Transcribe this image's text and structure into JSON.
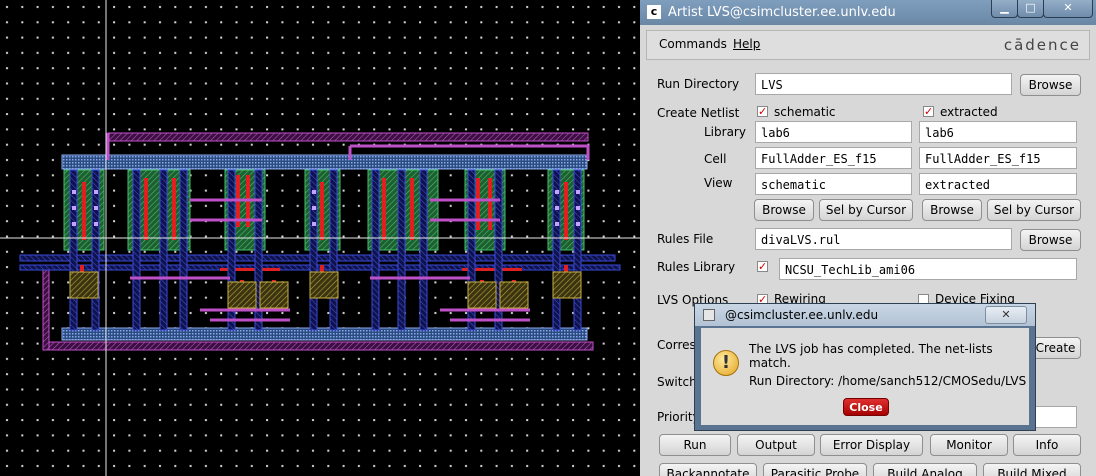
{
  "window": {
    "title": "Artist LVS@csimcluster.ee.unlv.edu",
    "app_icon": "cadence-c-icon",
    "controls": [
      "minimize-icon",
      "maximize-icon",
      "close-icon"
    ]
  },
  "menu": {
    "commands": "Commands",
    "help": "Help",
    "brand": "cādence"
  },
  "form": {
    "run_directory_label": "Run Directory",
    "run_directory_value": "LVS",
    "browse": "Browse",
    "create_netlist_label": "Create Netlist",
    "schematic_checkbox": "schematic",
    "extracted_checkbox": "extracted",
    "library_label": "Library",
    "cell_label": "Cell",
    "view_label": "View",
    "schematic": {
      "library": "lab6",
      "cell": "FullAdder_ES_f15",
      "view": "schematic"
    },
    "extracted": {
      "library": "lab6",
      "cell": "FullAdder_ES_f15",
      "view": "extracted"
    },
    "sel_by_cursor": "Sel by Cursor",
    "rules_file_label": "Rules File",
    "rules_file_value": "divaLVS.rul",
    "rules_library_label": "Rules Library",
    "rules_library_value": "NCSU_TechLib_ami06",
    "lvs_options_label": "LVS Options",
    "rewiring": "Rewiring",
    "device_fixing": "Device Fixing",
    "correspondence_label": "Corres",
    "create": "Create",
    "switch_label": "Switch",
    "priority_label": "Priority"
  },
  "buttons_row1": [
    "Run",
    "Output",
    "Error Display",
    "Monitor",
    "Info"
  ],
  "buttons_row2": [
    "Backannotate",
    "Parasitic Probe",
    "Build Analog",
    "Build Mixed"
  ],
  "dialog": {
    "title": "@csimcluster.ee.unlv.edu",
    "icon": "warning-icon",
    "message": "The LVS job has completed. The net-lists match.",
    "run_directory": "Run Directory: /home/sanch512/CMOSedu/LVS",
    "close": "Close"
  },
  "colors": {
    "layout_background": "#000000",
    "titlebar": "#6f8cab",
    "close_button": "#c00000",
    "checkmark": "#d00000"
  }
}
